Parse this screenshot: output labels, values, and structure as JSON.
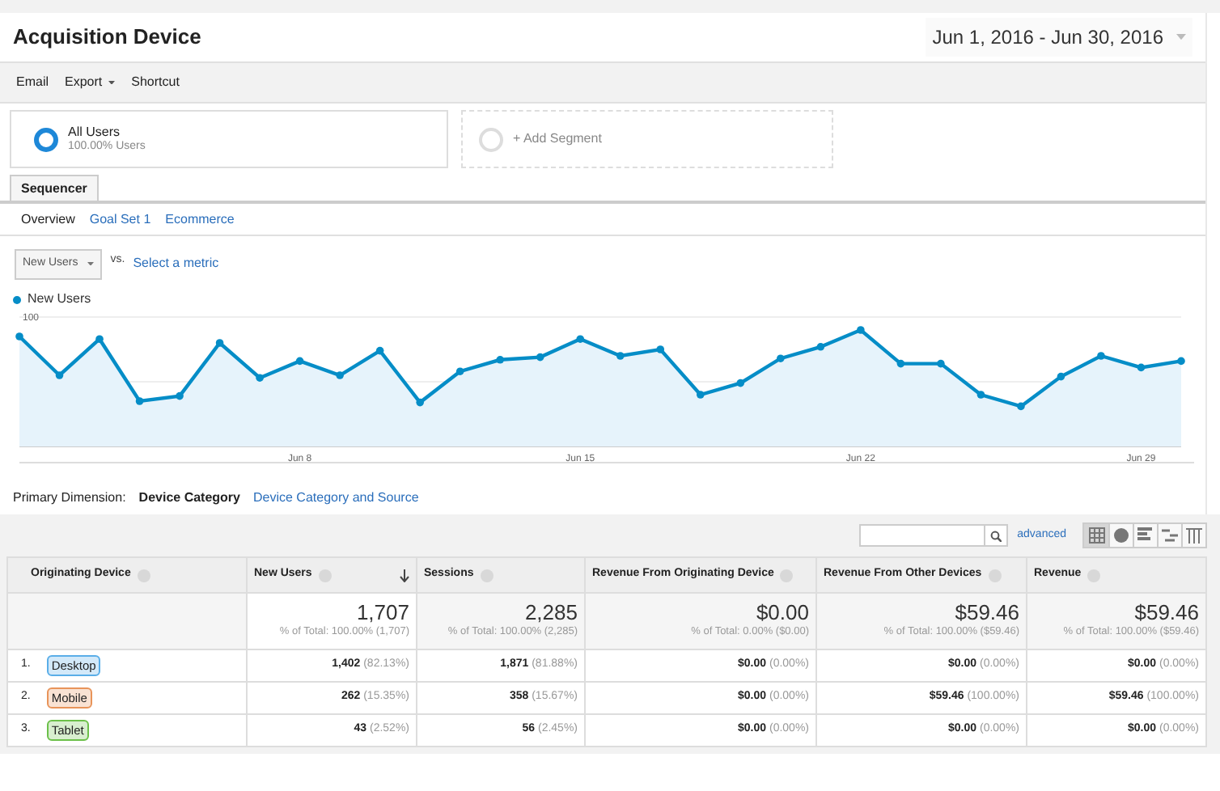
{
  "title": "Acquisition Device",
  "date_range": "Jun 1, 2016 - Jun 30, 2016",
  "toolbar": [
    {
      "label": "Email",
      "dropdown": false
    },
    {
      "label": "Export",
      "dropdown": true
    },
    {
      "label": "Shortcut",
      "dropdown": false
    }
  ],
  "segments": [
    {
      "kind": "active",
      "name": "All Users",
      "detail": "100.00% Users"
    },
    {
      "kind": "add",
      "name": "+ Add Segment"
    }
  ],
  "tabs": [
    {
      "label": "Sequencer",
      "selected": true
    }
  ],
  "subtabs": [
    {
      "label": "Overview",
      "selected": true
    },
    {
      "label": "Goal Set 1",
      "selected": false
    },
    {
      "label": "Ecommerce",
      "selected": false
    }
  ],
  "metric": {
    "value": "New Users",
    "vs": "vs.",
    "link": "Select a metric"
  },
  "chart": {
    "chart_data": {
      "type": "area",
      "categories": [
        null,
        null,
        null,
        null,
        null,
        null,
        null,
        "Jun 8",
        null,
        null,
        null,
        null,
        null,
        null,
        "Jun 15",
        null,
        null,
        null,
        null,
        null,
        null,
        "Jun 22",
        null,
        null,
        null,
        null,
        null,
        null,
        "Jun 29",
        null
      ],
      "series": [
        {
          "name": "New Users",
          "color": "#058dc7",
          "values": [
            85,
            55,
            83,
            35,
            39,
            80,
            53,
            66,
            55,
            74,
            34,
            58,
            67,
            69,
            83,
            70,
            75,
            40,
            49,
            68,
            77,
            90,
            64,
            64,
            40,
            31,
            54,
            70,
            61,
            66
          ]
        }
      ],
      "ylim": [
        0,
        100
      ],
      "yticks": [
        50,
        100
      ]
    }
  },
  "dimension": {
    "label": "Primary Dimension:",
    "options": [
      {
        "label": "Device Category",
        "selected": true
      },
      {
        "label": "Device Category and Source",
        "selected": false
      }
    ]
  },
  "search": {
    "button_label": "advanced"
  },
  "views": [
    {
      "kind": "table",
      "selected": true
    },
    {
      "kind": "pie",
      "selected": false
    },
    {
      "kind": "bars",
      "selected": false
    },
    {
      "kind": "compare",
      "selected": false
    },
    {
      "kind": "pivot",
      "selected": false
    }
  ],
  "table": {
    "columns": [
      {
        "label": "Originating Device",
        "sorted": false
      },
      {
        "label": "New Users",
        "sorted": true
      },
      {
        "label": "Sessions",
        "sorted": false
      },
      {
        "label": "Revenue From Originating Device",
        "sorted": false
      },
      {
        "label": "Revenue From Other Devices",
        "sorted": false
      },
      {
        "label": "Revenue",
        "sorted": false
      }
    ],
    "totals": [
      {
        "value": "1,707",
        "detail": "% of Total: 100.00% (1,707)"
      },
      {
        "value": "2,285",
        "detail": "% of Total: 100.00% (2,285)"
      },
      {
        "value": "$0.00",
        "detail": "% of Total: 0.00% ($0.00)"
      },
      {
        "value": "$59.46",
        "detail": "% of Total: 100.00% ($59.46)"
      },
      {
        "value": "$59.46",
        "detail": "% of Total: 100.00% ($59.46)"
      }
    ],
    "rows": [
      {
        "cells": [
          {
            "index": "1.",
            "device": "Desktop",
            "color": "#5aaee8"
          },
          {
            "value": "1,402",
            "share": "(82.13%)"
          },
          {
            "value": "1,871",
            "share": "(81.88%)"
          },
          {
            "value": "$0.00",
            "share": "(0.00%)"
          },
          {
            "value": "$0.00",
            "share": "(0.00%)"
          },
          {
            "value": "$0.00",
            "share": "(0.00%)"
          }
        ]
      },
      {
        "cells": [
          {
            "index": "2.",
            "device": "Mobile",
            "color": "#e8945a"
          },
          {
            "value": "262",
            "share": "(15.35%)"
          },
          {
            "value": "358",
            "share": "(15.67%)"
          },
          {
            "value": "$0.00",
            "share": "(0.00%)"
          },
          {
            "value": "$59.46",
            "share": "(100.00%)"
          },
          {
            "value": "$59.46",
            "share": "(100.00%)"
          }
        ]
      },
      {
        "cells": [
          {
            "index": "3.",
            "device": "Tablet",
            "color": "#6cc04a"
          },
          {
            "value": "43",
            "share": "(2.52%)"
          },
          {
            "value": "56",
            "share": "(2.45%)"
          },
          {
            "value": "$0.00",
            "share": "(0.00%)"
          },
          {
            "value": "$0.00",
            "share": "(0.00%)"
          },
          {
            "value": "$0.00",
            "share": "(0.00%)"
          }
        ]
      }
    ]
  }
}
